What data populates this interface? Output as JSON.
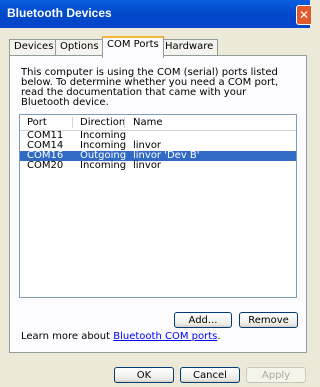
{
  "window": {
    "title": "Bluetooth Devices",
    "close_glyph": "✕"
  },
  "tabs": [
    {
      "label": "Devices"
    },
    {
      "label": "Options"
    },
    {
      "label": "COM Ports"
    },
    {
      "label": "Hardware"
    }
  ],
  "active_tab": "COM Ports",
  "description": "This computer is using the COM (serial) ports listed below. To determine whether you need a COM port, read the documentation that came with your Bluetooth device.",
  "list": {
    "columns": {
      "port": "Port",
      "direction": "Direction",
      "name": "Name"
    },
    "rows": [
      {
        "port": "COM11",
        "direction": "Incoming",
        "name": ""
      },
      {
        "port": "COM14",
        "direction": "Incoming",
        "name": "linvor"
      },
      {
        "port": "COM16",
        "direction": "Outgoing",
        "name": "linvor 'Dev B'",
        "selected": true
      },
      {
        "port": "COM20",
        "direction": "Incoming",
        "name": "linvor"
      }
    ]
  },
  "buttons": {
    "add": "Add...",
    "remove": "Remove",
    "ok": "OK",
    "cancel": "Cancel",
    "apply": "Apply"
  },
  "learn": {
    "prefix": "Learn more about ",
    "link": "Bluetooth COM ports",
    "suffix": "."
  },
  "colors": {
    "titlebar": "#0054e3",
    "selection": "#316ac5",
    "link": "#0000ff"
  }
}
